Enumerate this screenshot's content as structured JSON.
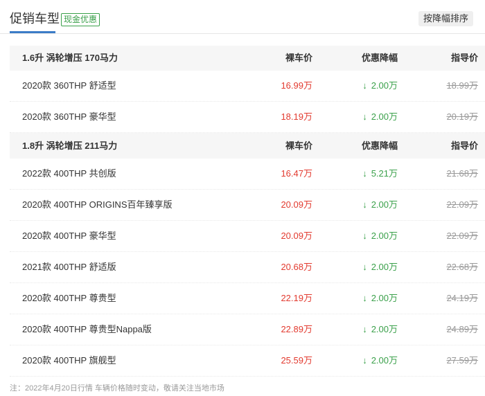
{
  "header": {
    "title": "促销车型",
    "badge": "现金优惠",
    "sort_button": "按降幅排序"
  },
  "groups": [
    {
      "label": "1.6升 涡轮增压 170马力",
      "col_price": "裸车价",
      "col_discount": "优惠降幅",
      "col_guide": "指导价",
      "rows": [
        {
          "name": "2020款 360THP 舒适型",
          "price": "16.99万",
          "discount": "2.00万",
          "guide": "18.99万"
        },
        {
          "name": "2020款 360THP 豪华型",
          "price": "18.19万",
          "discount": "2.00万",
          "guide": "20.19万"
        }
      ]
    },
    {
      "label": "1.8升 涡轮增压 211马力",
      "col_price": "裸车价",
      "col_discount": "优惠降幅",
      "col_guide": "指导价",
      "rows": [
        {
          "name": "2022款 400THP 共创版",
          "price": "16.47万",
          "discount": "5.21万",
          "guide": "21.68万"
        },
        {
          "name": "2020款 400THP ORIGINS百年臻享版",
          "price": "20.09万",
          "discount": "2.00万",
          "guide": "22.09万"
        },
        {
          "name": "2020款 400THP 豪华型",
          "price": "20.09万",
          "discount": "2.00万",
          "guide": "22.09万"
        },
        {
          "name": "2021款 400THP 舒适版",
          "price": "20.68万",
          "discount": "2.00万",
          "guide": "22.68万"
        },
        {
          "name": "2020款 400THP 尊贵型",
          "price": "22.19万",
          "discount": "2.00万",
          "guide": "24.19万"
        },
        {
          "name": "2020款 400THP 尊贵型Nappa版",
          "price": "22.89万",
          "discount": "2.00万",
          "guide": "24.89万"
        },
        {
          "name": "2020款 400THP 旗舰型",
          "price": "25.59万",
          "discount": "2.00万",
          "guide": "27.59万"
        }
      ]
    }
  ],
  "footer": "注：2022年4月20日行情 车辆价格随时变动，敬请关注当地市场",
  "icons": {
    "discount_arrow": "down-arrow-icon",
    "arrow_glyph": "↓"
  },
  "colors": {
    "price": "#e2392e",
    "discount": "#3aa04a",
    "accent": "#3b7cc7"
  }
}
